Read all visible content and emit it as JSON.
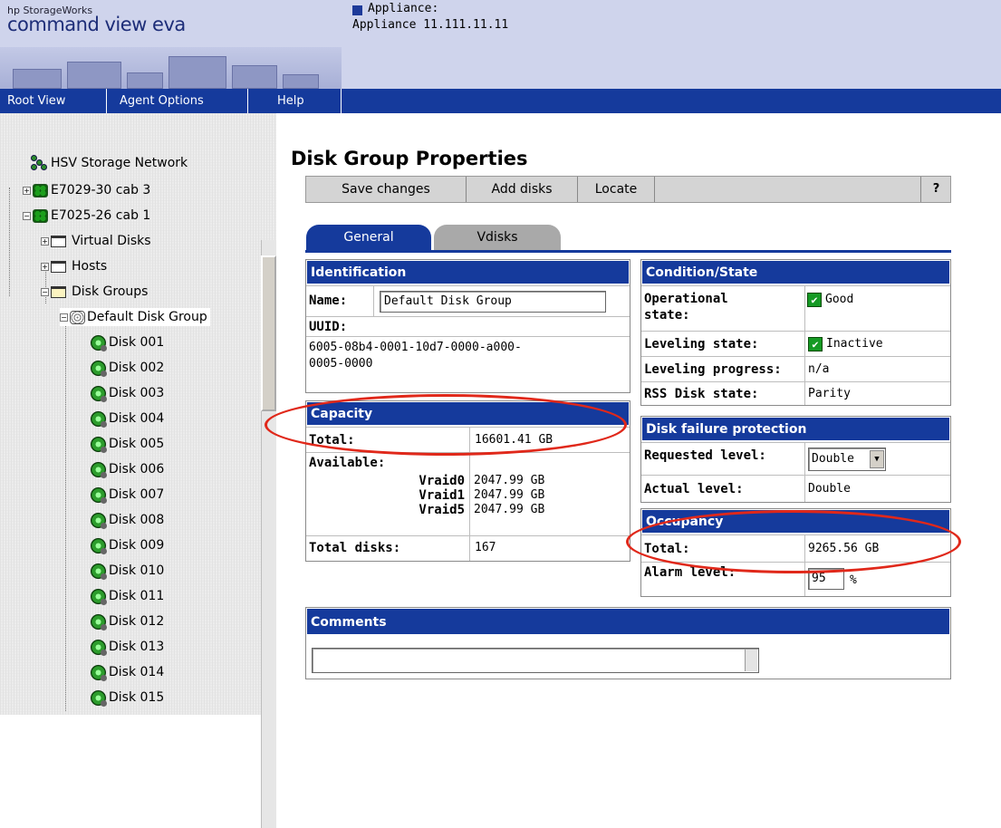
{
  "header": {
    "brand_small": "hp StorageWorks",
    "brand_main": "command view eva",
    "nav": [
      "Root View",
      "Agent Options",
      "Help"
    ],
    "appliance_label": "Appliance:",
    "appliance_value": "Appliance 11.111.11.11"
  },
  "tree": {
    "network": "HSV Storage Network",
    "cab1": "E7029-30 cab 3",
    "cab2": "E7025-26 cab 1",
    "virtual_disks": "Virtual Disks",
    "hosts": "Hosts",
    "disk_groups": "Disk Groups",
    "default_group": "Default Disk Group",
    "disks": [
      "Disk 001",
      "Disk 002",
      "Disk 003",
      "Disk 004",
      "Disk 005",
      "Disk 006",
      "Disk 007",
      "Disk 008",
      "Disk 009",
      "Disk 010",
      "Disk 011",
      "Disk 012",
      "Disk 013",
      "Disk 014",
      "Disk 015"
    ]
  },
  "page": {
    "title": "Disk Group Properties",
    "toolbar": {
      "save": "Save changes",
      "add": "Add disks",
      "locate": "Locate",
      "help": "?"
    },
    "tabs": {
      "general": "General",
      "vdisks": "Vdisks"
    }
  },
  "identification": {
    "header": "Identification",
    "name_label": "Name:",
    "name_value": "Default Disk Group",
    "uuid_label": "UUID:",
    "uuid_line1": "6005-08b4-0001-10d7-0000-a000-",
    "uuid_line2": "0005-0000"
  },
  "capacity": {
    "header": "Capacity",
    "total_label": "Total:",
    "total_value": "16601.41 GB",
    "available_label": "Available:",
    "vraid0_label": "Vraid0",
    "vraid0_value": "2047.99 GB",
    "vraid1_label": "Vraid1",
    "vraid1_value": "2047.99 GB",
    "vraid5_label": "Vraid5",
    "vraid5_value": "2047.99 GB",
    "disks_label": "Total disks:",
    "disks_value": "167"
  },
  "condition": {
    "header": "Condition/State",
    "op_label1": "Operational",
    "op_label2": "state:",
    "op_value": "Good",
    "leveling_label": "Leveling state:",
    "leveling_value": "Inactive",
    "progress_label": "Leveling progress:",
    "progress_value": "n/a",
    "rss_label": "RSS Disk state:",
    "rss_value": "Parity"
  },
  "protection": {
    "header": "Disk failure protection",
    "requested_label": "Requested level:",
    "requested_value": "Double",
    "actual_label": "Actual level:",
    "actual_value": "Double"
  },
  "occupancy": {
    "header": "Occupancy",
    "total_label": "Total:",
    "total_value": "9265.56 GB",
    "alarm_label": "Alarm level:",
    "alarm_value": "95",
    "alarm_unit": "%"
  },
  "comments": {
    "header": "Comments",
    "value": ""
  },
  "colors": {
    "accent": "#153a9c",
    "highlight_ellipse": "#e0281a",
    "check": "#159a24"
  }
}
